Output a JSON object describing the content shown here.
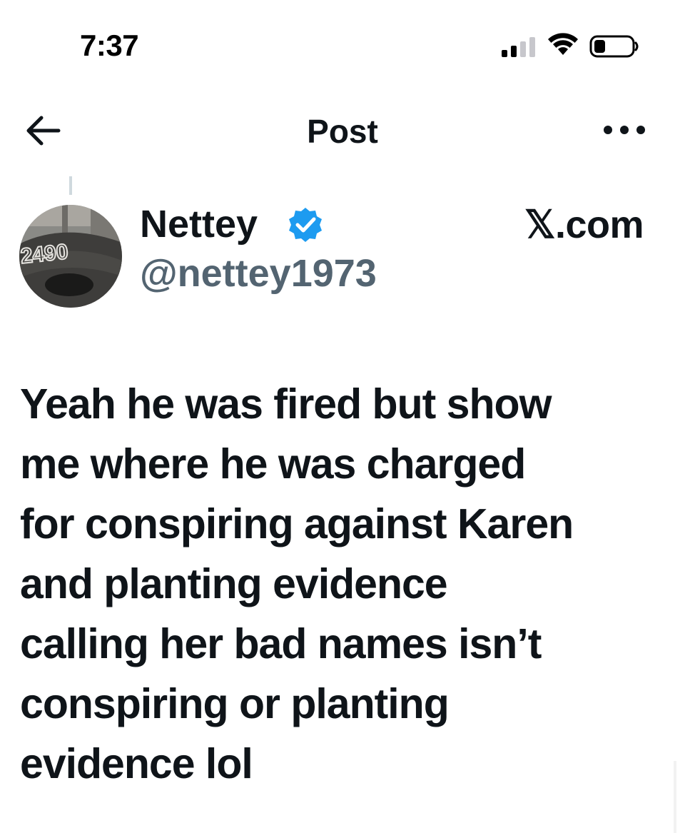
{
  "status_bar": {
    "time": "7:37",
    "signal_icon": "cellular-signal-icon",
    "wifi_icon": "wifi-icon",
    "battery_icon": "battery-icon",
    "battery_level": 0.3
  },
  "header": {
    "back_icon": "arrow-left-icon",
    "title": "Post",
    "more_icon": "more-horizontal-icon"
  },
  "author": {
    "name": "Nettey",
    "verified_icon": "verified-badge-icon",
    "verified_color": "#1d9bf0",
    "handle": "@nettey1973",
    "avatar_cap_text": "2490"
  },
  "brand": {
    "label": "𝕏.com"
  },
  "post": {
    "lines": [
      "Yeah he was fired but show",
      "me where he was charged",
      "for conspiring against Karen",
      "and planting evidence",
      "calling her bad names isn’t",
      "conspiring or planting",
      "evidence lol"
    ]
  },
  "colors": {
    "text_primary": "#0f1419",
    "text_secondary": "#536471",
    "accent": "#1d9bf0",
    "background": "#ffffff"
  }
}
